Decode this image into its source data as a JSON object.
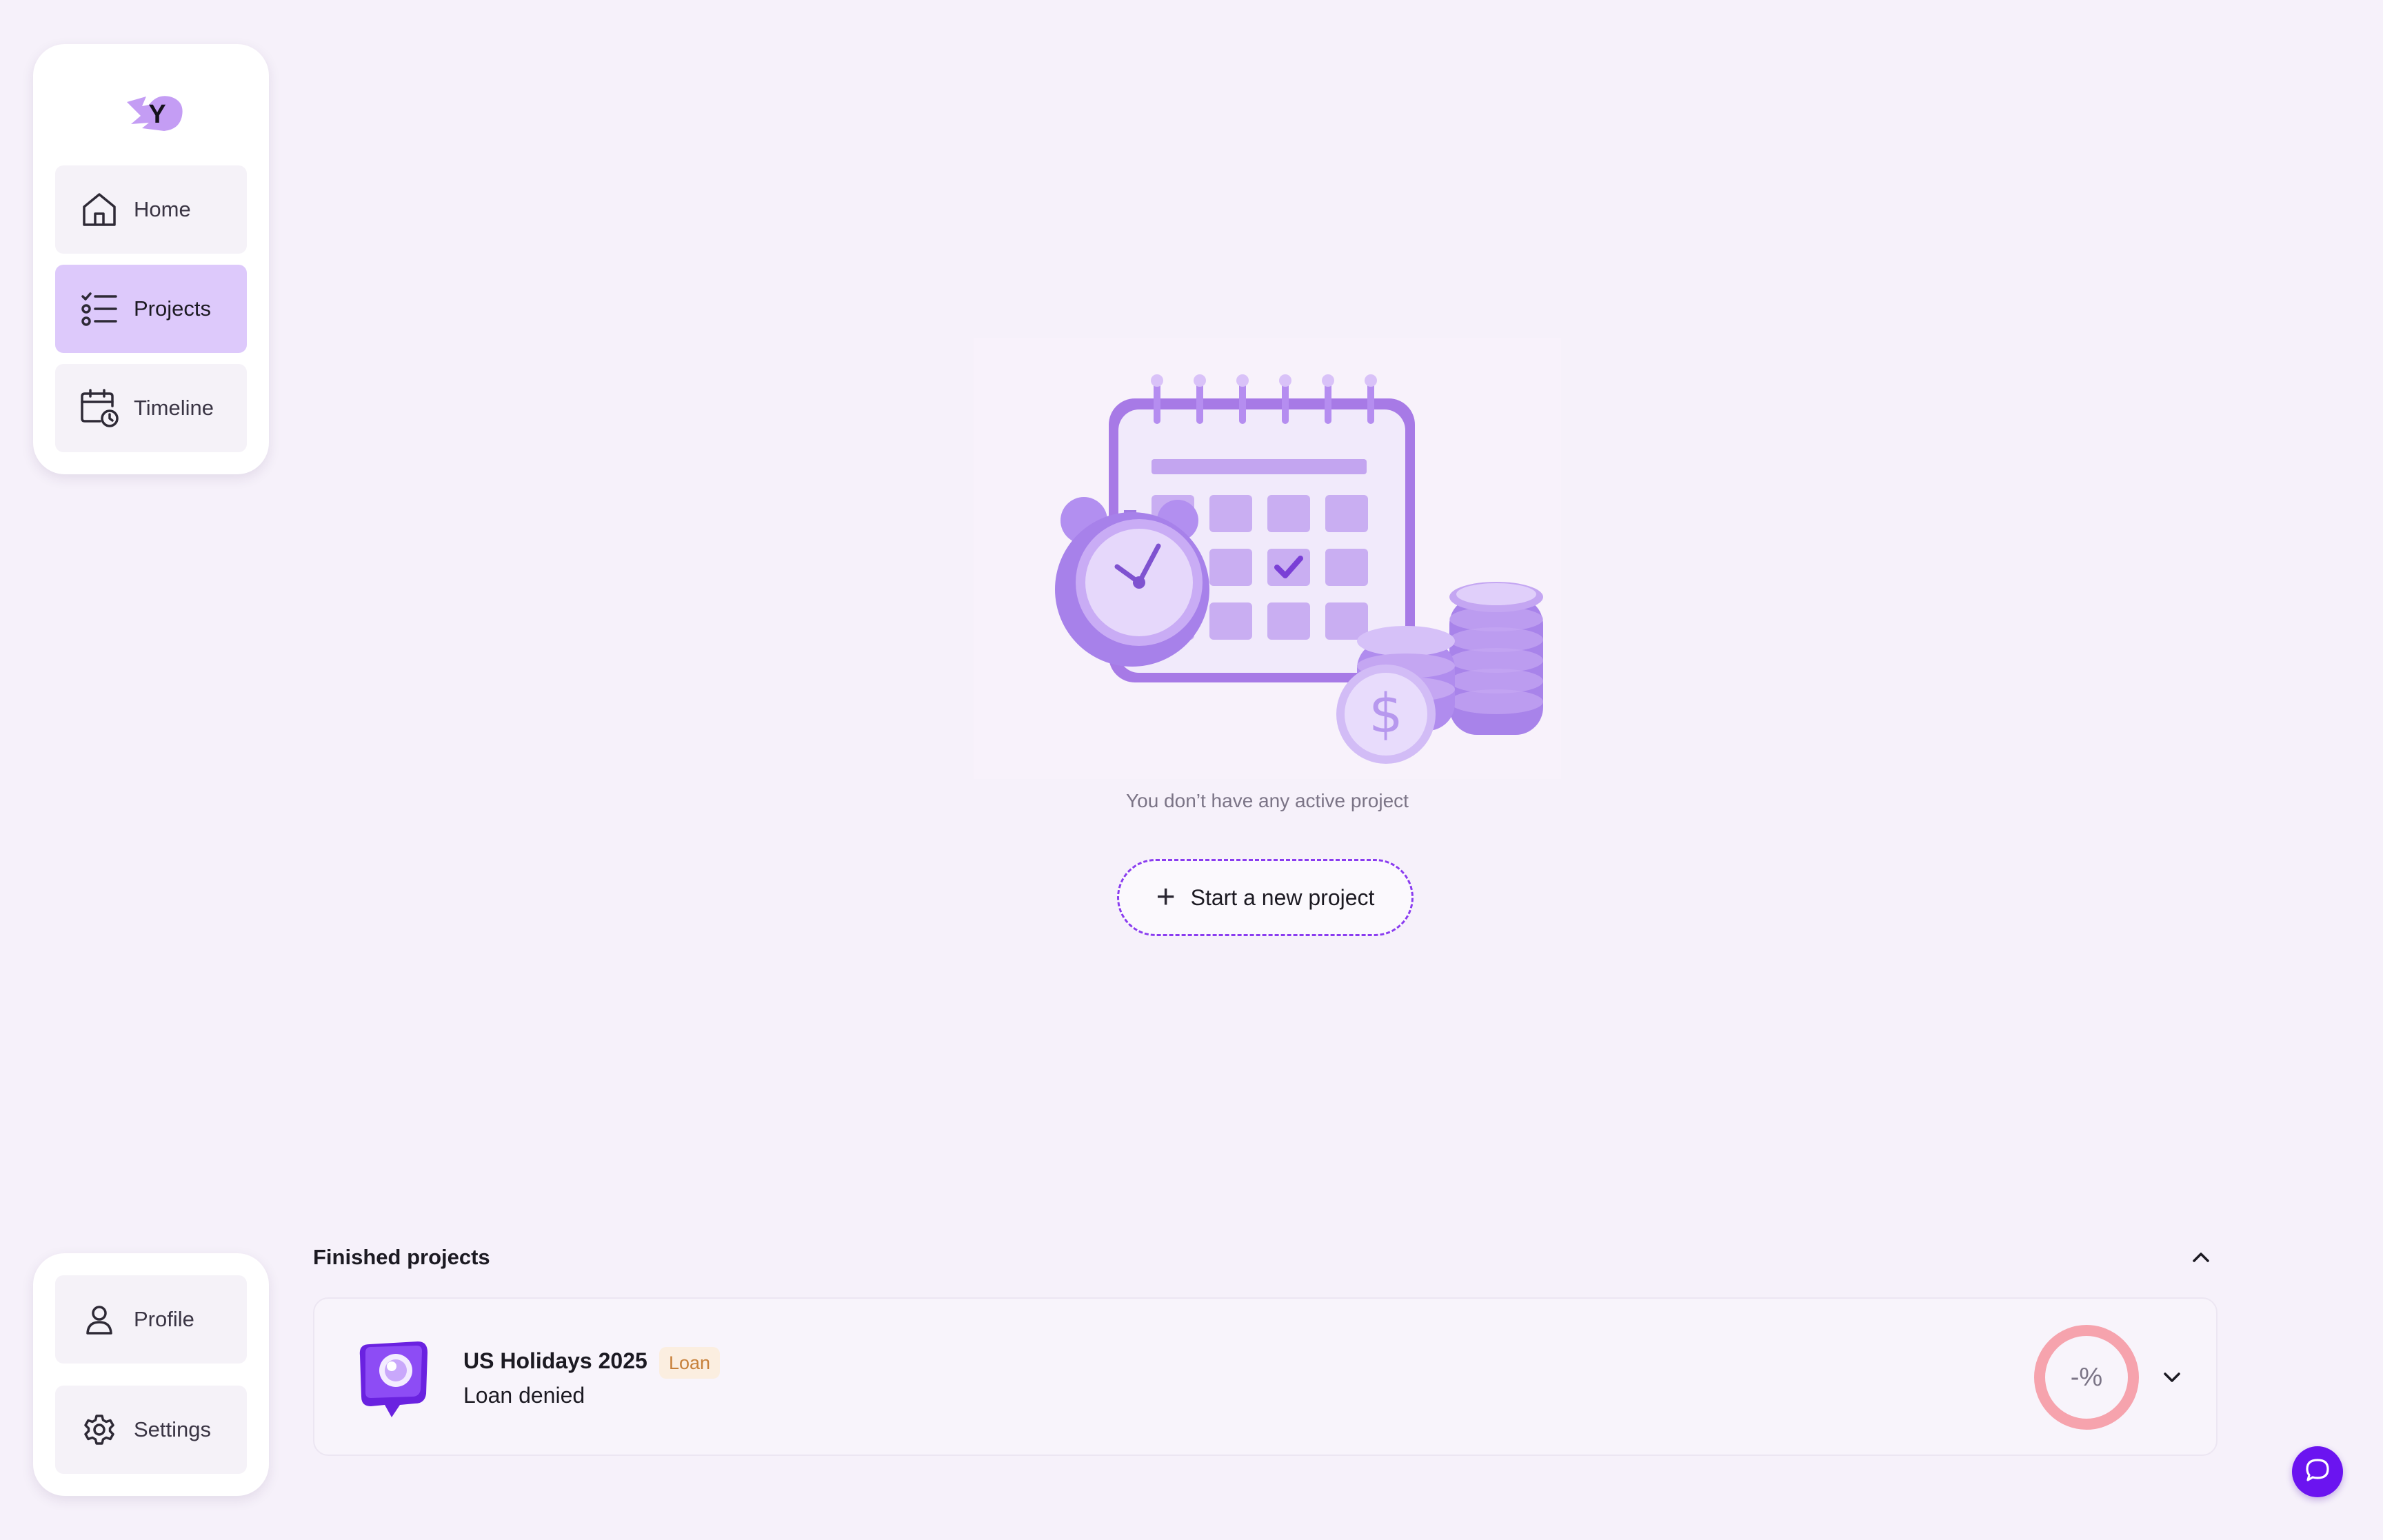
{
  "sidebar": {
    "logo_letter": "Y",
    "nav": [
      {
        "label": "Home",
        "icon": "home-icon",
        "active": false
      },
      {
        "label": "Projects",
        "icon": "checklist-icon",
        "active": true
      },
      {
        "label": "Timeline",
        "icon": "calendar-clock-icon",
        "active": false
      }
    ],
    "bottom": [
      {
        "label": "Profile",
        "icon": "user-icon"
      },
      {
        "label": "Settings",
        "icon": "gear-icon"
      }
    ]
  },
  "empty_state": {
    "illustration": "calendar-clock-coins-illustration",
    "message": "You don’t have any active project",
    "cta_label": "Start a new project",
    "cta_icon": "plus-icon"
  },
  "finished": {
    "title": "Finished projects",
    "toggle_icon": "chevron-up-icon",
    "projects": [
      {
        "name": "US Holidays 2025",
        "badge": "Loan",
        "status": "Loan denied",
        "progress_text": "-%",
        "expand_icon": "chevron-down-icon"
      }
    ]
  },
  "chat": {
    "icon": "chat-bubble-icon"
  },
  "colors": {
    "background": "#f6f1fa",
    "accent": "#8a3cf0",
    "active_nav": "#ddc9fb",
    "ring": "#f6a3ad",
    "badge_bg": "#fbeee0",
    "badge_text": "#c7803a",
    "fab": "#6b14f0"
  }
}
